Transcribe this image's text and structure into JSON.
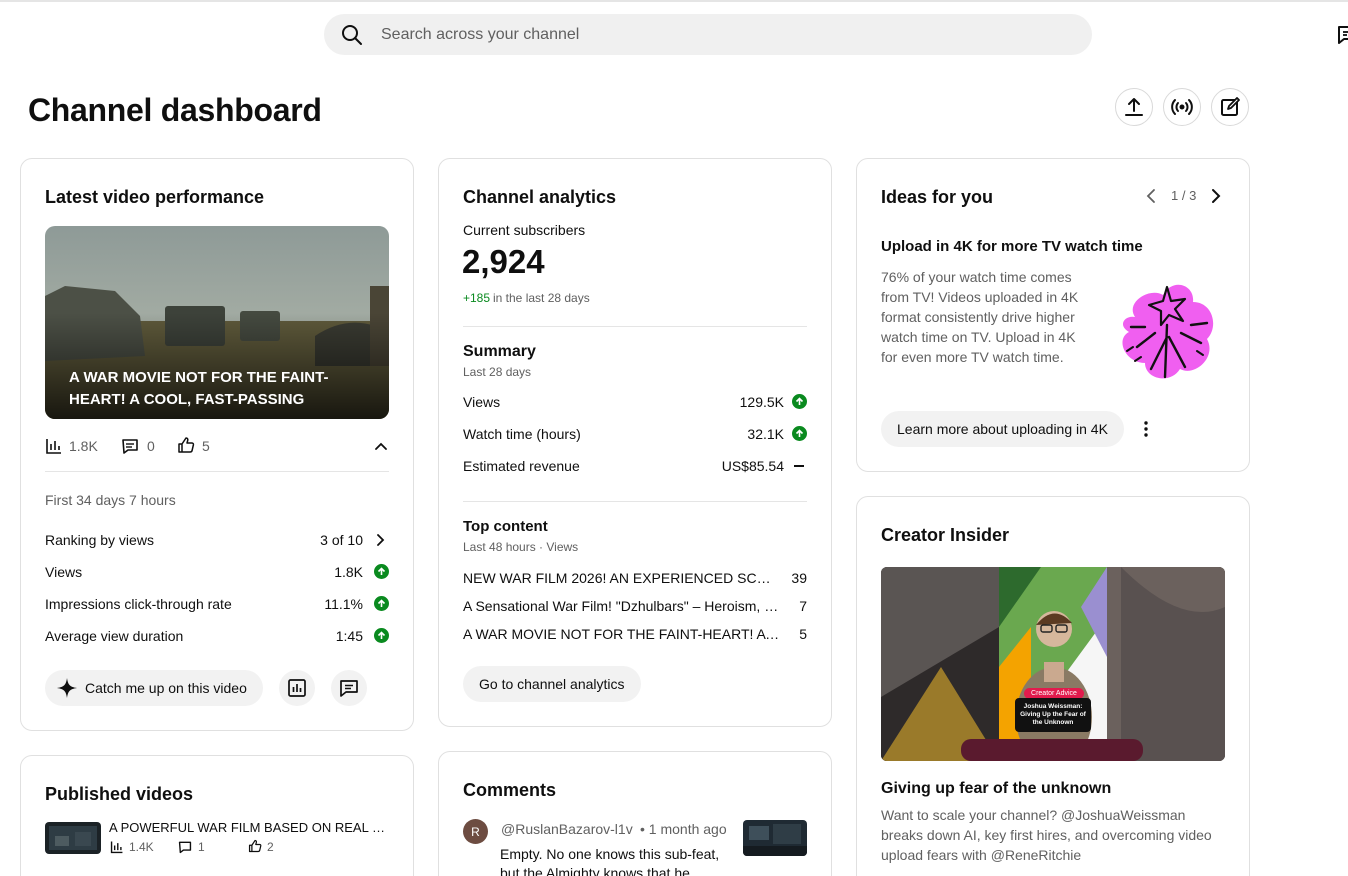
{
  "search": {
    "placeholder": "Search across your channel"
  },
  "page": {
    "title": "Channel dashboard"
  },
  "latest_video": {
    "title": "Latest video performance",
    "video_title": "A WAR MOVIE NOT FOR THE FAINT-HEART! A COOL, FAST-PASSING ACTIO…",
    "views_count": "1.8K",
    "comments_count": "0",
    "likes_count": "5",
    "period": "First 34 days 7 hours",
    "rows": [
      {
        "label": "Ranking by views",
        "value": "3 of 10"
      },
      {
        "label": "Views",
        "value": "1.8K"
      },
      {
        "label": "Impressions click-through rate",
        "value": "11.1%"
      },
      {
        "label": "Average view duration",
        "value": "1:45"
      }
    ],
    "catch_up_label": "Catch me up on this video"
  },
  "analytics": {
    "title": "Channel analytics",
    "subs_label": "Current subscribers",
    "subs_value": "2,924",
    "subs_delta": "+185",
    "subs_delta_suffix": "in the last 28 days",
    "summary_title": "Summary",
    "summary_period": "Last 28 days",
    "summary_rows": [
      {
        "label": "Views",
        "value": "129.5K",
        "trend": "up"
      },
      {
        "label": "Watch time (hours)",
        "value": "32.1K",
        "trend": "up"
      },
      {
        "label": "Estimated revenue",
        "value": "US$85.54",
        "trend": "flat"
      }
    ],
    "top_title": "Top content",
    "top_period": "Last 48 hours · Views",
    "top_rows": [
      {
        "title": "NEW WAR FILM 2026! AN EXPERIENCED SCOUT-…",
        "views": "39"
      },
      {
        "title": "A Sensational War Film! \"Dzhulbars\" – Heroism, D…",
        "views": "7"
      },
      {
        "title": "A WAR MOVIE NOT FOR THE FAINT-HEART! A CO…",
        "views": "5"
      }
    ],
    "cta": "Go to channel analytics"
  },
  "ideas": {
    "title": "Ideas for you",
    "pager": "1 / 3",
    "headline": "Upload in 4K for more TV watch time",
    "body": "76% of your watch time comes from TV! Videos uploaded in 4K format consistently drive higher watch time on TV. Upload in 4K for even more TV watch time.",
    "cta": "Learn more about uploading in 4K"
  },
  "insider": {
    "title": "Creator Insider",
    "badge": "Creator Advice",
    "card_text": "Joshua Weissman: Giving Up the Fear of the Unknown",
    "video_title": "Giving up fear of the unknown",
    "desc": "Want to scale your channel? @JoshuaWeissman breaks down AI, key first hires, and overcoming video upload fears with @ReneRitchie"
  },
  "published": {
    "title": "Published videos",
    "item_title": "A POWERFUL WAR FILM BASED ON REAL E…",
    "views": "1.4K",
    "comments": "1",
    "likes": "2"
  },
  "comments": {
    "title": "Comments",
    "avatar_letter": "R",
    "author": "@RuslanBazarov-l1v",
    "time": "• 1 month ago",
    "text": "Empty. No one knows this sub-feat, but the Almighty knows that he"
  },
  "colors": {
    "accent_green": "#0a8a1f",
    "idea_pink": "#f05ff0"
  }
}
